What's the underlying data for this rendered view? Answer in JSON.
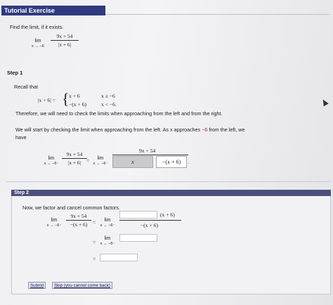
{
  "header": {
    "title": "Tutorial Exercise"
  },
  "problem": {
    "instruction": "Find the limit, if it exists.",
    "lim": "lim",
    "approach": "x → −6",
    "numerator": "9x + 54",
    "denominator": "|x + 6|"
  },
  "step1": {
    "label": "Step 1",
    "recall": "Recall that",
    "abs_lhs": "|x + 6| =",
    "case1_expr": "x + 6",
    "case1_cond": "x ≥ −6",
    "case2_expr": "−(x + 6)",
    "case2_cond": "x < −6.",
    "therefore": "Therefore, we will need to check the limits when approaching from the left and from the right.",
    "left_intro_a": "We will start by checking the limit when approaching from the left. As x approaches",
    "left_intro_val": "−6",
    "left_intro_b": "from the left, we",
    "left_intro_c": "have",
    "lim": "lim",
    "approach_left": "x → −6⁻",
    "numerator": "9x + 54",
    "denominator": "|x + 6|",
    "equals": "=",
    "rhs_numerator": "9x + 54",
    "answer_x": "x",
    "answer_den": "−(x + 6)",
    "period": "."
  },
  "step2": {
    "label": "Step 2",
    "text": "Now, we factor and cancel common factors.",
    "lim": "lim",
    "approach_left": "x → −6⁻",
    "numerator": "9x + 54",
    "denominator": "−(x + 6)",
    "equals": "=",
    "rhs_num": "(x + 6)",
    "rhs_den": "−(x + 6)"
  },
  "buttons": {
    "submit": "Submit",
    "skip": "Skip (you cannot come back)"
  }
}
